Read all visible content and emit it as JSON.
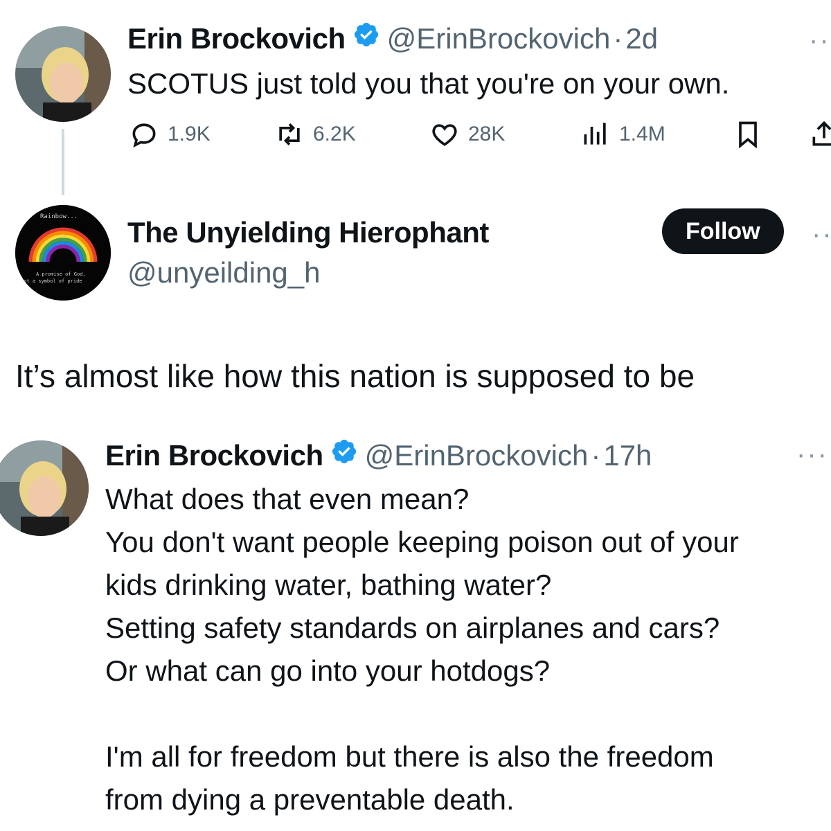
{
  "tweet1": {
    "author_name": "Erin Brockovich",
    "handle": "@ErinBrockovich",
    "separator": "·",
    "time": "2d",
    "text": "SCOTUS just told you that you're on your own.",
    "actions": {
      "replies": "1.9K",
      "retweets": "6.2K",
      "likes": "28K",
      "views": "1.4M"
    },
    "more": "··"
  },
  "profile": {
    "display_name": "The Unyielding Hierophant",
    "handle": "@unyeilding_h",
    "follow_label": "Follow",
    "more": "··",
    "avatar_text": {
      "top": "Rainbow...",
      "line1": "A promise of God,",
      "line2": "not a symbol of pride"
    }
  },
  "reply_text": "It’s almost like how this nation is supposed to be",
  "tweet2": {
    "author_name": "Erin Brockovich",
    "handle": "@ErinBrockovich",
    "separator": "·",
    "time": "17h",
    "more": "···",
    "lines": [
      "What does that even mean?",
      "You don't want people keeping poison out of your",
      "kids drinking water, bathing water?",
      "Setting safety standards on airplanes and cars?",
      "Or what can go into your hotdogs?",
      "",
      "I'm all for freedom but there is also the freedom",
      "from dying a preventable death."
    ]
  },
  "colors": {
    "verified": "#1d9bf0",
    "text_primary": "#0f1419",
    "text_secondary": "#536471",
    "thread_line": "#cfd9de"
  }
}
